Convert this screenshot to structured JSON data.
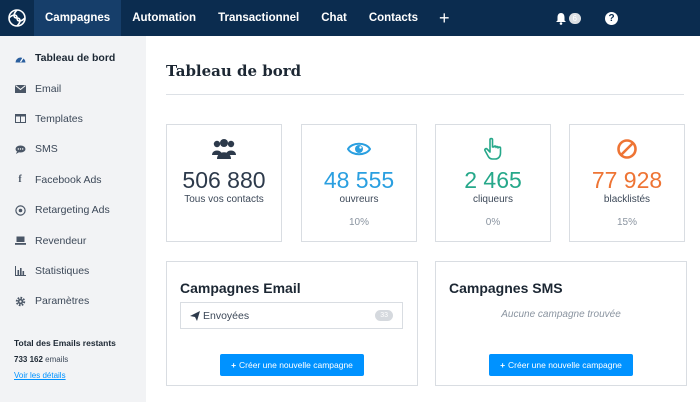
{
  "nav": {
    "items": [
      {
        "label": "Campagnes",
        "active": true
      },
      {
        "label": "Automation"
      },
      {
        "label": "Transactionnel"
      },
      {
        "label": "Chat"
      },
      {
        "label": "Contacts"
      }
    ],
    "plus_icon": "+",
    "notification_count": "6",
    "help_icon": "?"
  },
  "sidebar": {
    "items": [
      {
        "label": "Tableau de bord",
        "icon": "dashboard-icon",
        "active": true
      },
      {
        "label": "Email",
        "icon": "envelope-icon"
      },
      {
        "label": "Templates",
        "icon": "columns-icon"
      },
      {
        "label": "SMS",
        "icon": "chat-bubble-icon"
      },
      {
        "label": "Facebook Ads",
        "icon": "facebook-icon"
      },
      {
        "label": "Retargeting Ads",
        "icon": "target-icon"
      },
      {
        "label": "Revendeur",
        "icon": "reseller-icon"
      },
      {
        "label": "Statistiques",
        "icon": "bar-chart-icon"
      },
      {
        "label": "Paramètres",
        "icon": "gear-icon"
      }
    ],
    "footer": {
      "title": "Total des Emails restants",
      "count": "733 162",
      "count_suffix": "emails",
      "link": "Voir les détails"
    }
  },
  "main": {
    "title": "Tableau de bord",
    "stats": [
      {
        "value": "506 880",
        "label": "Tous vos contacts",
        "pct": "",
        "color": "#2d3a4b",
        "icon": "users-icon"
      },
      {
        "value": "48 555",
        "label": "ouvreurs",
        "pct": "10%",
        "color": "#2a9fe0",
        "icon": "eye-icon"
      },
      {
        "value": "2 465",
        "label": "cliqueurs",
        "pct": "0%",
        "color": "#26a88a",
        "icon": "hand-pointer-icon"
      },
      {
        "value": "77 928",
        "label": "blacklistés",
        "pct": "15%",
        "color": "#ee7434",
        "icon": "ban-icon"
      }
    ],
    "email_panel": {
      "title": "Campagnes Email",
      "sent_label": "Envoyées",
      "sent_count": "33",
      "button": "Créer une nouvelle campagne"
    },
    "sms_panel": {
      "title": "Campagnes SMS",
      "empty_text": "Aucune campagne trouvée",
      "button": "Créer une nouvelle campagne"
    }
  }
}
